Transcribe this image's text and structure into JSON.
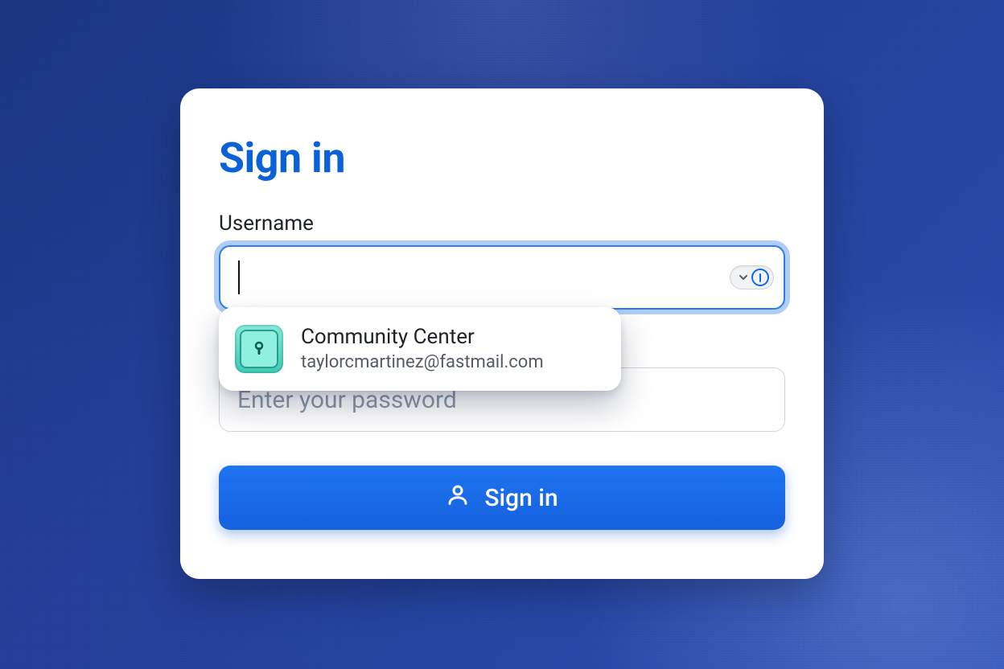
{
  "form": {
    "heading": "Sign in",
    "username_label": "Username",
    "username_value": "",
    "password_placeholder": "Enter your password",
    "submit_label": "Sign in"
  },
  "autofill_suggestion": {
    "title": "Community Center",
    "subtitle": "taylorcmartinez@fastmail.com"
  }
}
